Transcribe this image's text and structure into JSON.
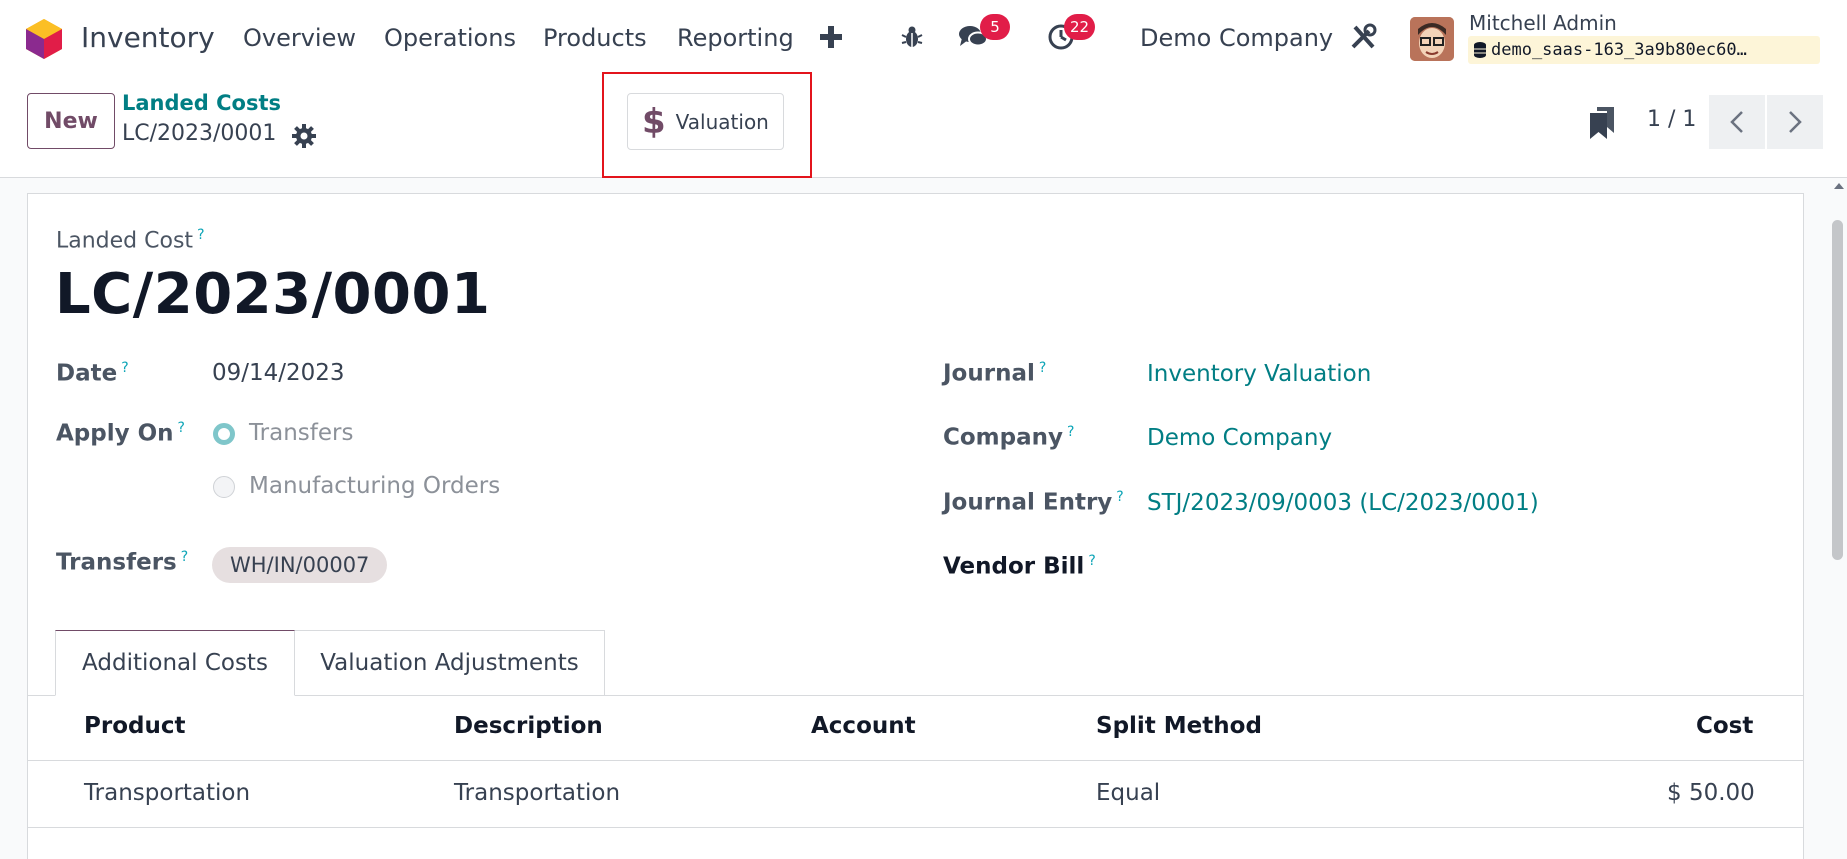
{
  "navbar": {
    "app_name": "Inventory",
    "menus": [
      "Overview",
      "Operations",
      "Products",
      "Reporting"
    ],
    "messages_count": "5",
    "activities_count": "22",
    "company": "Demo Company",
    "user_name": "Mitchell Admin",
    "database": "demo_saas-163_3a9b80ec60…"
  },
  "control_panel": {
    "new_label": "New",
    "breadcrumb_parent": "Landed Costs",
    "breadcrumb_current": "LC/2023/0001",
    "valuation_label": "Valuation",
    "pager": "1 / 1"
  },
  "form": {
    "title_label": "Landed Cost",
    "title": "LC/2023/0001",
    "date_label": "Date",
    "date_value": "09/14/2023",
    "apply_on_label": "Apply On",
    "apply_on_options": [
      "Transfers",
      "Manufacturing Orders"
    ],
    "transfers_label": "Transfers",
    "transfer_tag": "WH/IN/00007",
    "journal_label": "Journal",
    "journal_value": "Inventory Valuation",
    "company_label": "Company",
    "company_value": "Demo Company",
    "journal_entry_label": "Journal Entry",
    "journal_entry_value": "STJ/2023/09/0003 (LC/2023/0001)",
    "vendor_bill_label": "Vendor Bill",
    "help_mark": "?"
  },
  "tabs": [
    "Additional Costs",
    "Valuation Adjustments"
  ],
  "table": {
    "headers": [
      "Product",
      "Description",
      "Account",
      "Split Method",
      "Cost"
    ],
    "rows": [
      [
        "Transportation",
        "Transportation",
        "",
        "Equal",
        "$ 50.00"
      ]
    ]
  },
  "colors": {
    "brand": "#714b67",
    "link": "#017e84",
    "badge": "#e11d48",
    "highlight": "#e3141c"
  }
}
